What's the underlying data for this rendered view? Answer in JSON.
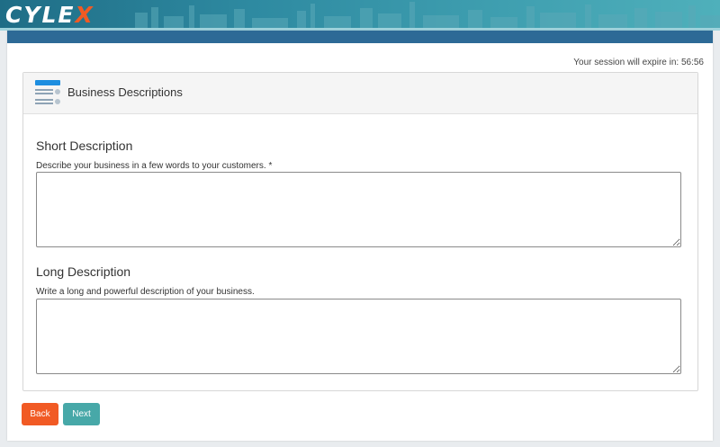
{
  "brand": {
    "logo_prefix": "CYLE",
    "logo_x": "X"
  },
  "session": {
    "text": "Your session will expire in: 56:56"
  },
  "card": {
    "title": "Business Descriptions",
    "icon": "list-icon"
  },
  "short_description": {
    "title": "Short Description",
    "label": "Describe your business in a few words to your customers. *",
    "value": ""
  },
  "long_description": {
    "title": "Long Description",
    "label": "Write a long and powerful description of your business.",
    "value": ""
  },
  "buttons": {
    "back": "Back",
    "next": "Next"
  },
  "colors": {
    "header": "#2d6a96",
    "back": "#f15a24",
    "next": "#47a8a8",
    "brand_accent": "#f15a24"
  }
}
